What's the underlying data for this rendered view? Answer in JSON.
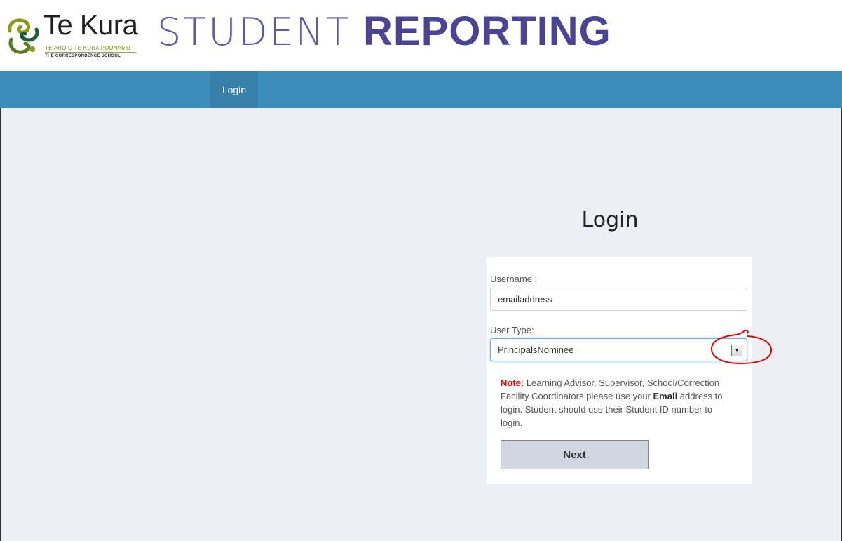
{
  "brand": {
    "name": "Te Kura",
    "subtitle_maori": "TE AHO O TE KURA POUNAMU",
    "subtitle_english": "THE CORRESPONDENCE SCHOOL",
    "logo_icon": "te-kura-koru-logo"
  },
  "header": {
    "title_light": "STUDENT",
    "title_bold": "REPORTING"
  },
  "nav": {
    "items": [
      {
        "label": "Login",
        "active": true
      }
    ]
  },
  "login": {
    "title": "Login",
    "username_label": "Username :",
    "username_value": "emailaddress",
    "user_type_label": "User Type:",
    "user_type_value": "PrincipalsNominee",
    "note": {
      "label": "Note:",
      "text_1": " Learning Advisor, Supervisor, School/Correction Facility Coordinators please use your ",
      "email_word": "Email",
      "text_2": " address to login. Student should use their Student ID number to login."
    },
    "next_button": "Next"
  },
  "colors": {
    "navbar": "#3c8dbc",
    "nav_active": "#367fa9",
    "title_purple": "#4a4396",
    "content_bg": "#ecf0f5",
    "annotation_red": "#e00000"
  }
}
